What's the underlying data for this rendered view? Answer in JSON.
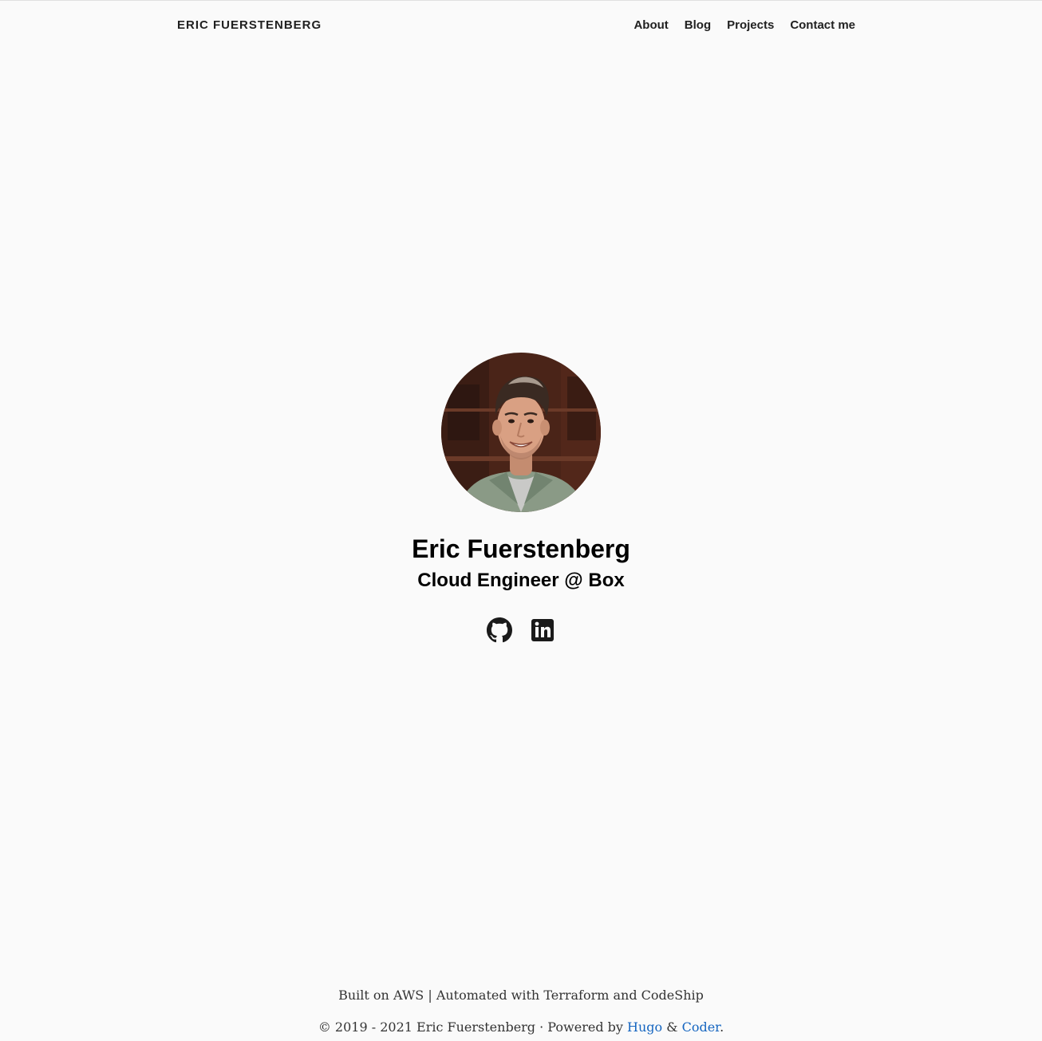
{
  "header": {
    "brand": "ERIC FUERSTENBERG",
    "nav": [
      {
        "label": "About"
      },
      {
        "label": "Blog"
      },
      {
        "label": "Projects"
      },
      {
        "label": "Contact me"
      }
    ]
  },
  "profile": {
    "avatar_icon": "person-photo-icon",
    "name": "Eric Fuerstenberg",
    "tagline": "Cloud Engineer @ Box",
    "social": [
      {
        "icon": "github-icon"
      },
      {
        "icon": "linkedin-icon"
      }
    ]
  },
  "footer": {
    "line1": "Built on AWS | Automated with Terraform and CodeShip",
    "line2_prefix": "© 2019 - 2021 Eric Fuerstenberg · Powered by ",
    "hugo": "Hugo",
    "amp": " & ",
    "coder": "Coder",
    "suffix": "."
  },
  "colors": {
    "background": "#fafafa",
    "text": "#212121",
    "link": "#1565c0"
  }
}
